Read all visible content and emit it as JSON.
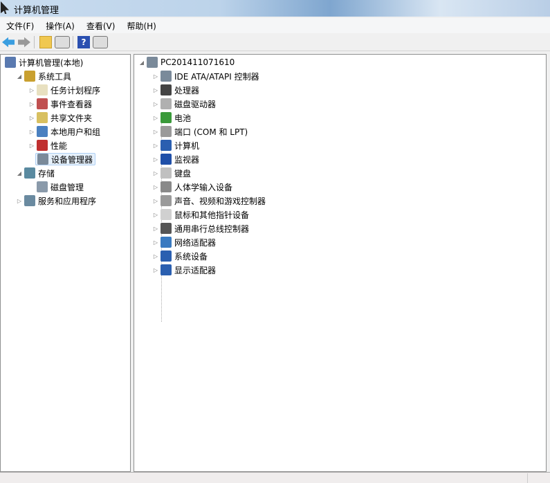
{
  "window": {
    "title": "计算机管理"
  },
  "menu": [
    "文件(F)",
    "操作(A)",
    "查看(V)",
    "帮助(H)"
  ],
  "toolbar": {
    "icons": [
      "back-arrow-icon",
      "forward-arrow-icon",
      "up-folder-icon",
      "show-hide-console-tree-icon",
      "help-icon",
      "show-hide-action-pane-icon"
    ]
  },
  "left_tree": [
    {
      "label": "计算机管理(本地)",
      "level": 0,
      "expander": "",
      "icon": "computer-management-icon"
    },
    {
      "label": "系统工具",
      "level": 1,
      "expander": "expanded",
      "icon": "system-tools-icon"
    },
    {
      "label": "任务计划程序",
      "level": 2,
      "expander": "collapsed",
      "icon": "clock-icon"
    },
    {
      "label": "事件查看器",
      "level": 2,
      "expander": "collapsed",
      "icon": "event-viewer-icon"
    },
    {
      "label": "共享文件夹",
      "level": 2,
      "expander": "collapsed",
      "icon": "shared-folder-icon"
    },
    {
      "label": "本地用户和组",
      "level": 2,
      "expander": "collapsed",
      "icon": "users-icon"
    },
    {
      "label": "性能",
      "level": 2,
      "expander": "collapsed",
      "icon": "performance-icon"
    },
    {
      "label": "设备管理器",
      "level": 2,
      "expander": "",
      "icon": "device-manager-icon",
      "selected": true
    },
    {
      "label": "存储",
      "level": 1,
      "expander": "expanded",
      "icon": "storage-icon"
    },
    {
      "label": "磁盘管理",
      "level": 2,
      "expander": "",
      "icon": "disk-management-icon"
    },
    {
      "label": "服务和应用程序",
      "level": 1,
      "expander": "collapsed",
      "icon": "services-icon"
    }
  ],
  "device_tree": {
    "root": "PC201411071610",
    "items": [
      "IDE ATA/ATAPI 控制器",
      "处理器",
      "磁盘驱动器",
      "电池",
      "端口 (COM 和 LPT)",
      "计算机",
      "监视器",
      "键盘",
      "人体学输入设备",
      "声音、视频和游戏控制器",
      "鼠标和其他指针设备",
      "通用串行总线控制器",
      "网络适配器",
      "系统设备",
      "显示适配器"
    ],
    "icons": [
      "ide-controller-icon",
      "processor-icon",
      "disk-drive-icon",
      "battery-icon",
      "port-icon",
      "computer-icon",
      "monitor-icon",
      "keyboard-icon",
      "hid-icon",
      "sound-icon",
      "mouse-icon",
      "usb-icon",
      "network-adapter-icon",
      "system-device-icon",
      "display-adapter-icon"
    ]
  },
  "colors": {
    "icon": [
      "#7a8a9a",
      "#444444",
      "#b0b0b0",
      "#3a9a3a",
      "#9a9a9a",
      "#2a5fb0",
      "#1f4fa8",
      "#c0c0c0",
      "#8a8a8a",
      "#9a9a9a",
      "#d0d0d0",
      "#555555",
      "#3a7ac0",
      "#2a5fb0",
      "#2a5fb0"
    ]
  }
}
